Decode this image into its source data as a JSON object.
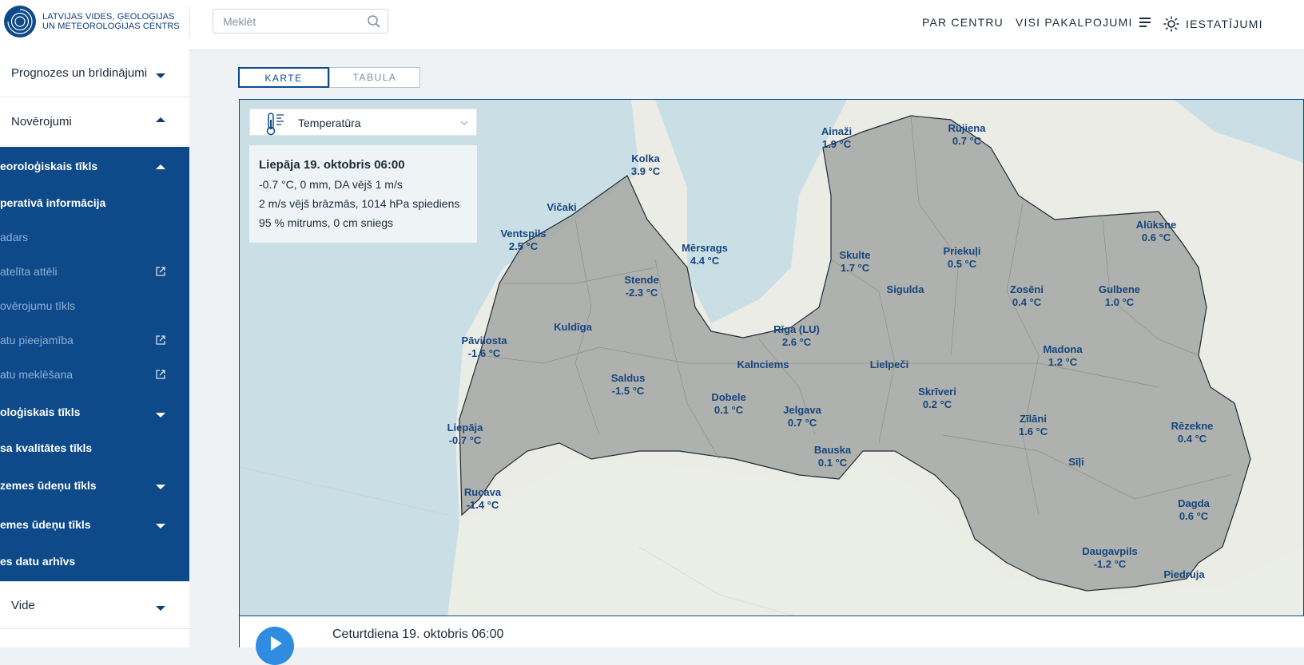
{
  "header": {
    "logo_line1": "LATVIJAS VIDES, ĢEOLOĢIJAS",
    "logo_line2": "UN METEOROLOĢIJAS CENTRS",
    "search_placeholder": "Meklēt",
    "nav": {
      "about": "PAR CENTRU",
      "services": "VISI PAKALPOJUMI",
      "settings": "IESTATĪJUMI"
    }
  },
  "sidebar": {
    "forecasts": "Prognozes un brīdinājumi",
    "observations": "Novērojumi",
    "meteo_network": "eoroloģiskais tīkls",
    "operational": "perativā informācija",
    "radar": "adars",
    "satellite": "atelīta attēli",
    "obs_network": "ovērojumu tīkls",
    "data_availability": "atu pieejamība",
    "data_search": "atu meklēšana",
    "hydro_network": "oloģiskais tīkls",
    "air_quality": "sa kvalitātes tīkls",
    "surface_water": "zemes ūdeņu tīkls",
    "ground_water": "emes ūdeņu tīkls",
    "data_archive": "es datu arhīvs",
    "environment": "Vide"
  },
  "tabs": {
    "map": "KARTE",
    "table": "TABULA"
  },
  "map": {
    "parameter": "Temperatūra",
    "info": {
      "title": "Liepāja 19. oktobris 06:00",
      "line1": "-0.7 °C, 0 mm, DA vējš 1 m/s",
      "line2": "2 m/s vējš brāzmās, 1014 hPa spiediens",
      "line3": "95 % mitrums, 0 cm sniegs"
    },
    "stations": [
      {
        "name": "Ainaži",
        "temp": "1.9 °C"
      },
      {
        "name": "Rūjiena",
        "temp": "0.7 °C"
      },
      {
        "name": "Kolka",
        "temp": "3.9 °C"
      },
      {
        "name": "Vičaki",
        "temp": ""
      },
      {
        "name": "Ventspils",
        "temp": "2.5 °C"
      },
      {
        "name": "Mērsrags",
        "temp": "4.4 °C"
      },
      {
        "name": "Skulte",
        "temp": "1.7 °C"
      },
      {
        "name": "Priekuļi",
        "temp": "0.5 °C"
      },
      {
        "name": "Alūksne",
        "temp": "0.6 °C"
      },
      {
        "name": "Stende",
        "temp": "-2.3 °C"
      },
      {
        "name": "Sigulda",
        "temp": ""
      },
      {
        "name": "Zosēni",
        "temp": "0.4 °C"
      },
      {
        "name": "Gulbene",
        "temp": "1.0 °C"
      },
      {
        "name": "Kuldīga",
        "temp": ""
      },
      {
        "name": "Pāvilosta",
        "temp": "-1.6 °C"
      },
      {
        "name": "Rīga (LU)",
        "temp": "2.6 °C"
      },
      {
        "name": "Madona",
        "temp": "1.2 °C"
      },
      {
        "name": "Kalnciems",
        "temp": ""
      },
      {
        "name": "Lielpeči",
        "temp": ""
      },
      {
        "name": "Saldus",
        "temp": "-1.5 °C"
      },
      {
        "name": "Dobele",
        "temp": "0.1 °C"
      },
      {
        "name": "Jelgava",
        "temp": "0.7 °C"
      },
      {
        "name": "Skrīveri",
        "temp": "0.2 °C"
      },
      {
        "name": "Zīlāni",
        "temp": "1.6 °C"
      },
      {
        "name": "Liepāja",
        "temp": "-0.7 °C"
      },
      {
        "name": "Rēzekne",
        "temp": "0.4 °C"
      },
      {
        "name": "Bauska",
        "temp": "0.1 °C"
      },
      {
        "name": "Sīļi",
        "temp": ""
      },
      {
        "name": "Rucava",
        "temp": "-1.4 °C"
      },
      {
        "name": "Dagda",
        "temp": "0.6 °C"
      },
      {
        "name": "Daugavpils",
        "temp": "-1.2 °C"
      },
      {
        "name": "Piedruja",
        "temp": ""
      }
    ]
  },
  "player": {
    "date": "Ceturtdiena 19. oktobris 06:00"
  },
  "colors": {
    "brand": "#0e4a8a",
    "play": "#2f8ce0",
    "station_text": "#17457e"
  }
}
